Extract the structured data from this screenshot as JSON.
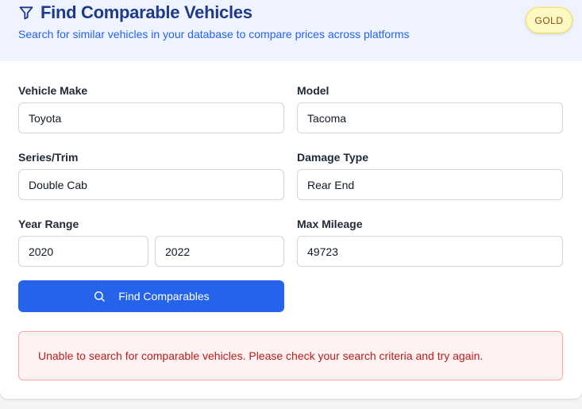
{
  "header": {
    "title": "Find Comparable Vehicles",
    "subtitle": "Search for similar vehicles in your database to compare prices across platforms",
    "badge": "GOLD"
  },
  "form": {
    "make": {
      "label": "Vehicle Make",
      "value": "Toyota"
    },
    "model": {
      "label": "Model",
      "value": "Tacoma"
    },
    "series": {
      "label": "Series/Trim",
      "value": "Double Cab"
    },
    "damage": {
      "label": "Damage Type",
      "value": "Rear End"
    },
    "year_range": {
      "label": "Year Range",
      "from": "2020",
      "to": "2022"
    },
    "mileage": {
      "label": "Max Mileage",
      "value": "49723"
    },
    "submit_label": "Find Comparables"
  },
  "error_message": "Unable to search for comparable vehicles. Please check your search criteria and try again.",
  "colors": {
    "header_bg": "#eef3fe",
    "title": "#1e3a8a",
    "accent": "#2563eb",
    "badge_bg": "#fef9c3",
    "error_text": "#b91c1c",
    "error_bg": "#fef2f2"
  },
  "icons": {
    "title_icon": "filter-icon",
    "button_icon": "search-icon"
  }
}
